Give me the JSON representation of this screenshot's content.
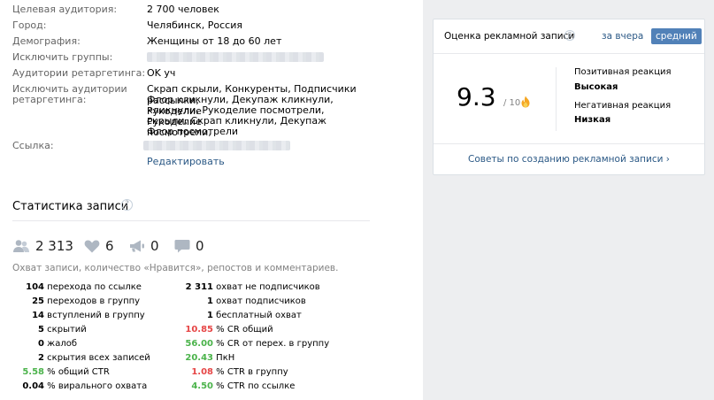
{
  "targeting": {
    "audience_label": "Целевая аудитория:",
    "audience_value": "2 700 человек",
    "city_label": "Город:",
    "city_value": "Челябинск, Россия",
    "demo_label": "Демография:",
    "demo_value": "Женщины от 18 до 60 лет",
    "exclude_groups_label": "Исключить группы:",
    "retarget_label": "Аудитории ретаргетинга:",
    "retarget_value": "OK уч",
    "exclude_retarget_label_1": "Исключить аудитории",
    "exclude_retarget_label_2": "ретаргетинга:",
    "exclude_retarget_lines": [
      "Скрап скрыли, Конкуренты, Подписчики рассылки,",
      "Флор кликнули, Декупаж кликнули, Рукоделие",
      "кликнули, Рукоделие посмотрели, Рукоделие",
      "скрыли, Скрап кликнули, Декупаж посмотрели,",
      "Флор посмотрели"
    ],
    "link_label": "Ссылка:",
    "edit_link": "Редактировать"
  },
  "stats": {
    "title": "Статистика записи",
    "help_icon": "?",
    "reach": "2 313",
    "likes": "6",
    "reposts": "0",
    "comments": "0",
    "description": "Охват записи, количество «Нравится», репостов и комментариев.",
    "left_col": [
      {
        "num": "104",
        "text": " перехода по ссылке"
      },
      {
        "num": "25",
        "text": " переходов в группу"
      },
      {
        "num": "14",
        "text": " вступлений в группу"
      },
      {
        "num": "5",
        "text": " скрытий"
      },
      {
        "num": "0",
        "text": " жалоб"
      },
      {
        "num": "2",
        "text": " скрытия всех записей"
      },
      {
        "num": "5.58",
        "text": " % общий CTR"
      },
      {
        "num": "0.04",
        "text": " % вирального охвата"
      }
    ],
    "right_col": [
      {
        "num": "2 311",
        "text": " охват не подписчиков"
      },
      {
        "num": "1",
        "text": " охват подписчиков"
      },
      {
        "num": "1",
        "text": " бесплатный охват"
      },
      {
        "num": "10.85",
        "text": " % CR общий"
      },
      {
        "num": "56.00",
        "text": " % CR от перех. в группу"
      },
      {
        "num": "20.43",
        "text": " ПкН"
      },
      {
        "num": "1.08",
        "text": " % CTR в группу"
      },
      {
        "num": "4.50",
        "text": " % CTR по ссылке"
      }
    ],
    "colors": {
      "red": "#e64646",
      "green": "#4bb34b"
    }
  },
  "rating_card": {
    "title": "Оценка рекламной записи",
    "beta_badge": "β",
    "tab_yesterday": "за вчера",
    "tab_average": "средний",
    "score": "9.3",
    "score_of": "/ 10",
    "positive_label": "Позитивная реакция",
    "positive_value": "Высокая",
    "negative_label": "Негативная реакция",
    "negative_value": "Низкая",
    "tips_link": "Советы по созданию рекламной записи ›"
  }
}
